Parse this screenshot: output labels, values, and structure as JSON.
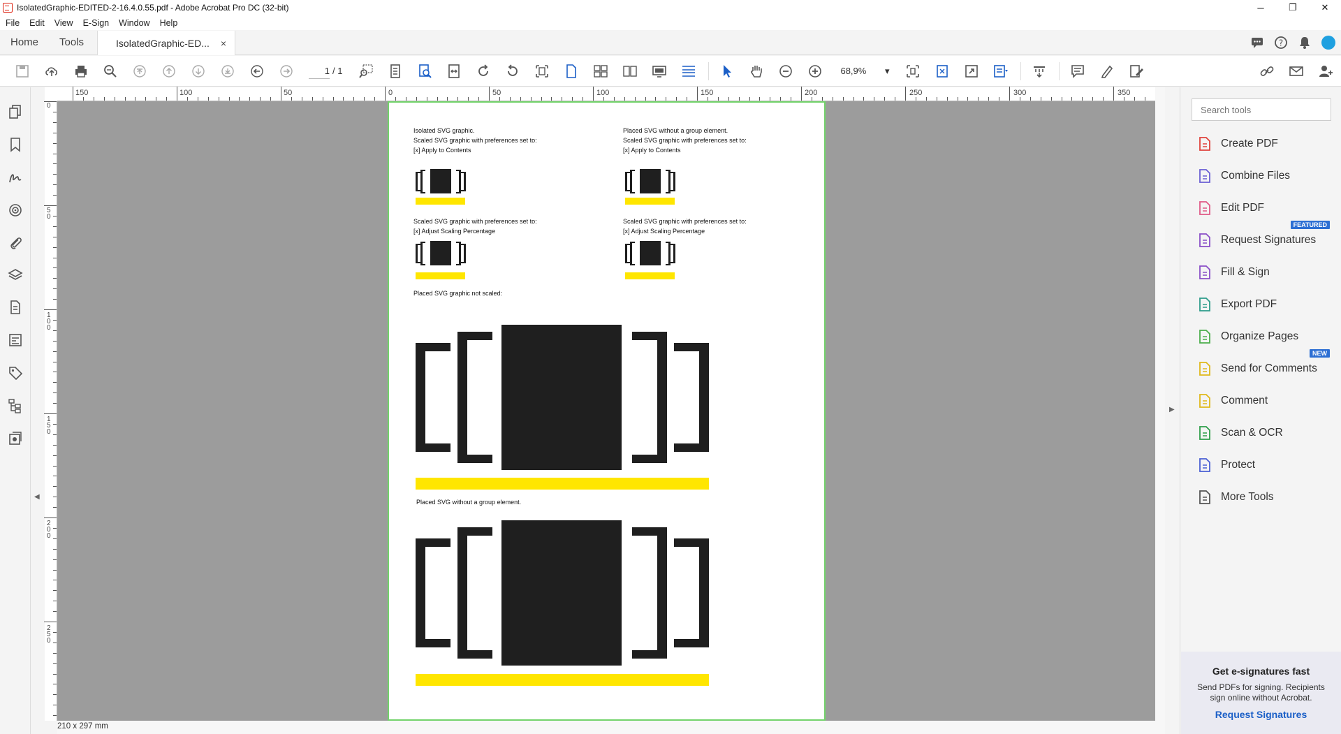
{
  "window": {
    "title": "IsolatedGraphic-EDITED-2-16.4.0.55.pdf - Adobe Acrobat Pro DC (32-bit)",
    "minimize": "─",
    "maximize": "❐",
    "close": "✕"
  },
  "menu": [
    "File",
    "Edit",
    "View",
    "E-Sign",
    "Window",
    "Help"
  ],
  "tabs": {
    "home": "Home",
    "tools": "Tools",
    "document": "IsolatedGraphic-ED...",
    "close": "×"
  },
  "toolbar": {
    "page_current": "1",
    "page_total": "/ 1",
    "zoom": "68,9%",
    "zoom_arrow": "▾"
  },
  "ruler": {
    "top_labels": [
      "150",
      "100",
      "50",
      "0",
      "50",
      "100",
      "150",
      "200",
      "250",
      "300",
      "350"
    ],
    "left_labels": [
      "0",
      "5 0",
      "1 0 0",
      "1 5 0",
      "2 0 0",
      "2 5 0"
    ]
  },
  "document": {
    "block1_left": "Isolated SVG graphic.\nScaled SVG graphic with preferences set to:\n[x] Apply to Contents",
    "block1_right": "Placed SVG without a group element.\nScaled SVG graphic with preferences set to:\n[x] Apply to Contents",
    "block2_left": "Scaled SVG graphic with preferences set to:\n[x] Adjust Scaling Percentage",
    "block2_right": "Scaled SVG graphic with preferences set to:\n[x] Adjust Scaling Percentage",
    "label_not_scaled": "Placed SVG graphic not scaled:",
    "label_no_group": "Placed SVG without a group element.",
    "page_size": "210 x 297 mm"
  },
  "tools_pane": {
    "search_placeholder": "Search tools",
    "items": [
      {
        "label": "Create PDF",
        "icon": "create-pdf-icon",
        "color": "#e0423c"
      },
      {
        "label": "Combine Files",
        "icon": "combine-files-icon",
        "color": "#6b5fd3"
      },
      {
        "label": "Edit PDF",
        "icon": "edit-pdf-icon",
        "color": "#e05a87"
      },
      {
        "label": "Request Signatures",
        "icon": "request-signatures-icon",
        "color": "#8a4fc7",
        "badge": "FEATURED"
      },
      {
        "label": "Fill & Sign",
        "icon": "fill-sign-icon",
        "color": "#8a4fc7"
      },
      {
        "label": "Export PDF",
        "icon": "export-pdf-icon",
        "color": "#2d9c8a"
      },
      {
        "label": "Organize Pages",
        "icon": "organize-pages-icon",
        "color": "#4cae4c"
      },
      {
        "label": "Send for Comments",
        "icon": "send-for-comments-icon",
        "color": "#e0b81a",
        "badge": "NEW"
      },
      {
        "label": "Comment",
        "icon": "comment-icon",
        "color": "#e0b81a"
      },
      {
        "label": "Scan & OCR",
        "icon": "scan-ocr-icon",
        "color": "#2e9e4a"
      },
      {
        "label": "Protect",
        "icon": "protect-icon",
        "color": "#4a5fd3"
      },
      {
        "label": "More Tools",
        "icon": "more-tools-icon",
        "color": "#555555"
      }
    ],
    "promo": {
      "heading": "Get e-signatures fast",
      "body": "Send PDFs for signing. Recipients sign online without Acrobat.",
      "link": "Request Signatures"
    }
  },
  "colors": {
    "accent": "#1b5fc7",
    "page_border": "#73d36b",
    "highlight_bar": "#ffe600",
    "graphic": "#1f1f1f"
  }
}
